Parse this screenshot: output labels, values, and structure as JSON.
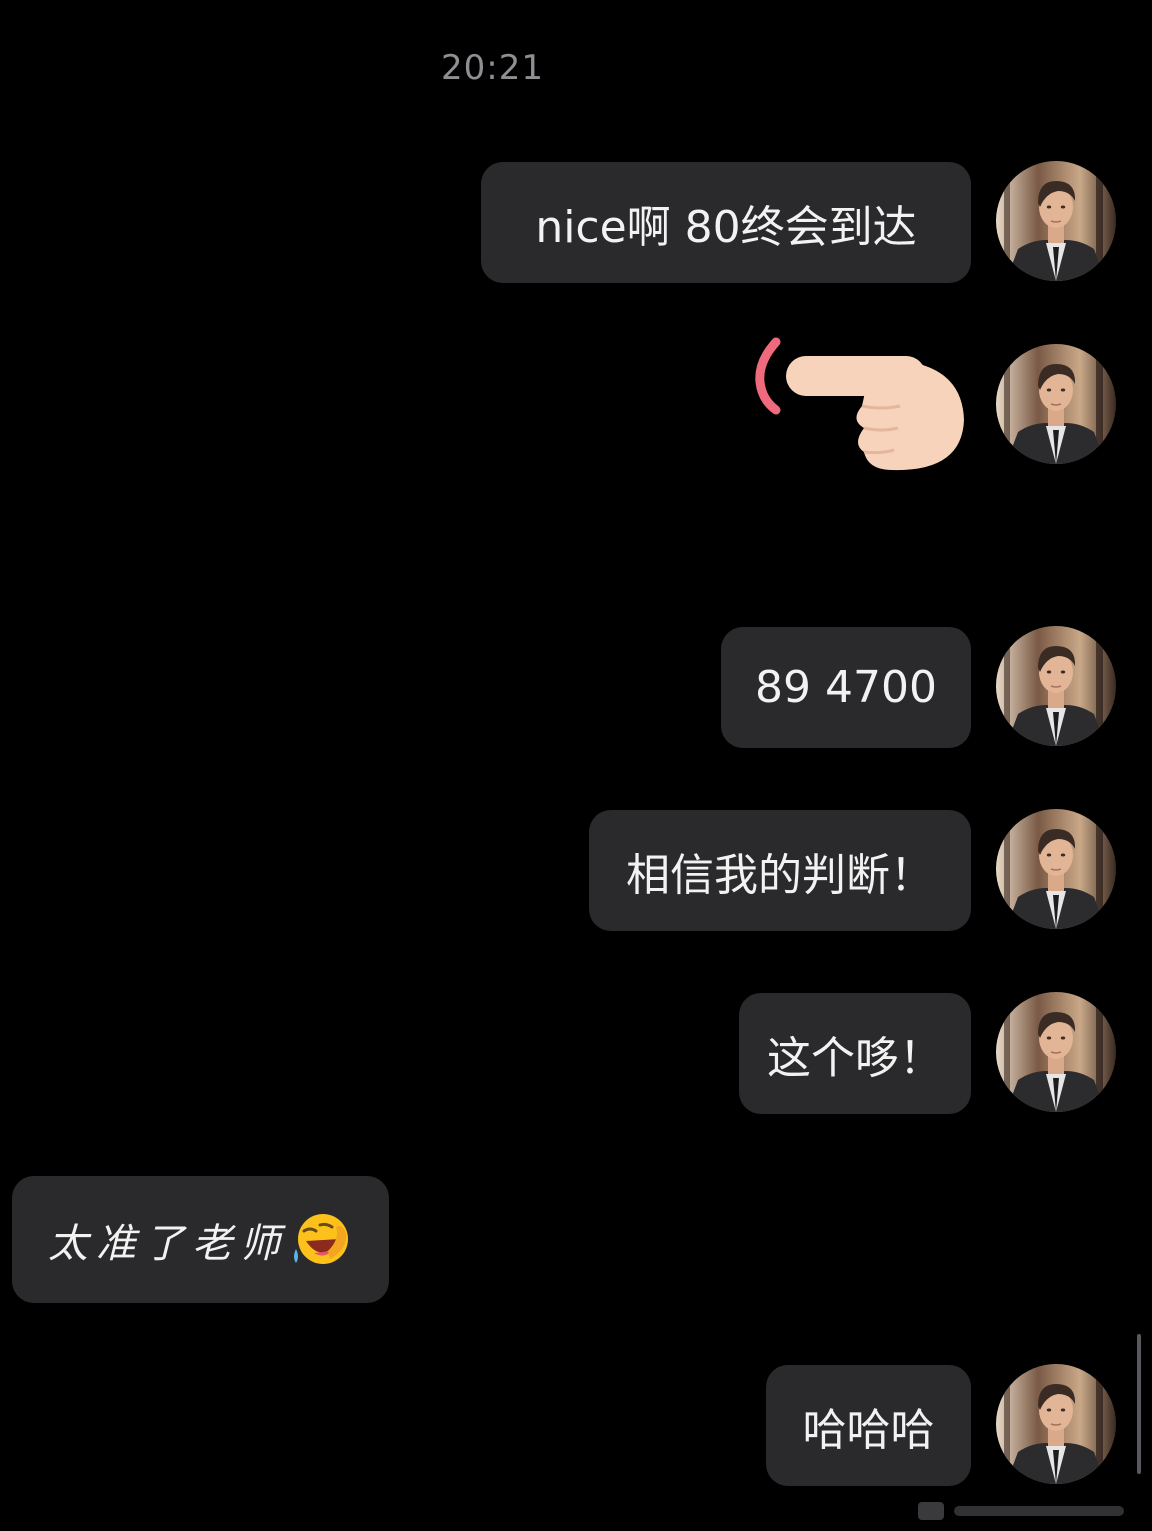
{
  "chat": {
    "timestamp": "20:21",
    "messages": [
      {
        "id": "m1",
        "direction": "outgoing",
        "type": "text",
        "text": "nice啊 80终会到达"
      },
      {
        "id": "m2",
        "direction": "outgoing",
        "type": "emoji",
        "icon": "pointing-finger-emoji"
      },
      {
        "id": "m3",
        "direction": "outgoing",
        "type": "text",
        "text": "89 4700"
      },
      {
        "id": "m4",
        "direction": "outgoing",
        "type": "text",
        "text": "相信我的判断！"
      },
      {
        "id": "m5",
        "direction": "outgoing",
        "type": "text",
        "text": "这个哆！"
      },
      {
        "id": "m6",
        "direction": "incoming",
        "type": "text",
        "text": "太准了老师",
        "trailing_icon": "laughing-tears-emoji"
      },
      {
        "id": "m7",
        "direction": "outgoing",
        "type": "text",
        "text": "哈哈哈"
      }
    ]
  },
  "colors": {
    "background": "#000000",
    "bubble": "#2a2a2c",
    "text": "#f2f2f2",
    "timestamp": "#8e8e93"
  }
}
